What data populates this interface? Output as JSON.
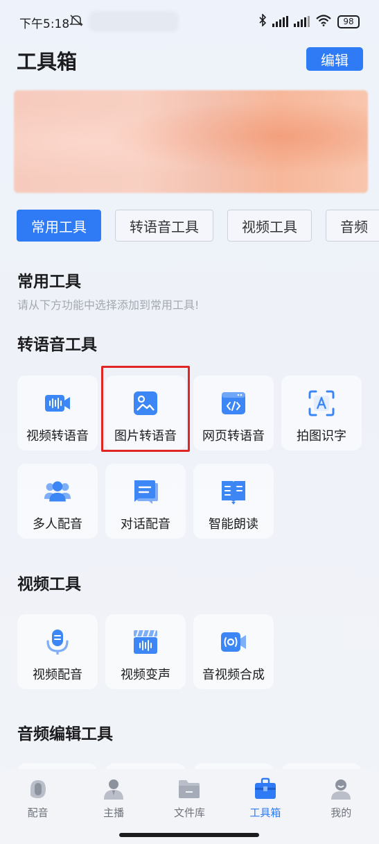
{
  "status_bar": {
    "time": "下午5:18",
    "battery": "98"
  },
  "header": {
    "title": "工具箱",
    "edit_label": "编辑"
  },
  "tabs": [
    {
      "label": "常用工具",
      "active": true
    },
    {
      "label": "转语音工具",
      "active": false
    },
    {
      "label": "视频工具",
      "active": false
    },
    {
      "label": "音频",
      "active": false
    }
  ],
  "sections": {
    "common": {
      "title": "常用工具",
      "hint": "请从下方功能中选择添加到常用工具!"
    },
    "tts": {
      "title": "转语音工具",
      "items": [
        {
          "label": "视频转语音",
          "icon": "video-audio-icon"
        },
        {
          "label": "图片转语音",
          "icon": "image-icon"
        },
        {
          "label": "网页转语音",
          "icon": "webpage-code-icon"
        },
        {
          "label": "拍图识字",
          "icon": "text-scan-icon"
        },
        {
          "label": "多人配音",
          "icon": "multi-user-icon"
        },
        {
          "label": "对话配音",
          "icon": "chat-bubble-icon"
        },
        {
          "label": "智能朗读",
          "icon": "book-icon"
        }
      ]
    },
    "video": {
      "title": "视频工具",
      "items": [
        {
          "label": "视频配音",
          "icon": "microphone-icon"
        },
        {
          "label": "视频变声",
          "icon": "clapperboard-icon"
        },
        {
          "label": "音视频合成",
          "icon": "camera-icon"
        }
      ]
    },
    "audio": {
      "title": "音频编辑工具"
    }
  },
  "bottom_nav": [
    {
      "label": "配音",
      "icon": "dubbing-icon",
      "active": false
    },
    {
      "label": "主播",
      "icon": "anchor-user-icon",
      "active": false
    },
    {
      "label": "文件库",
      "icon": "folder-icon",
      "active": false
    },
    {
      "label": "工具箱",
      "icon": "toolbox-icon",
      "active": true
    },
    {
      "label": "我的",
      "icon": "profile-icon",
      "active": false
    }
  ],
  "colors": {
    "accent": "#2f7bf5",
    "highlight": "#e12424"
  }
}
